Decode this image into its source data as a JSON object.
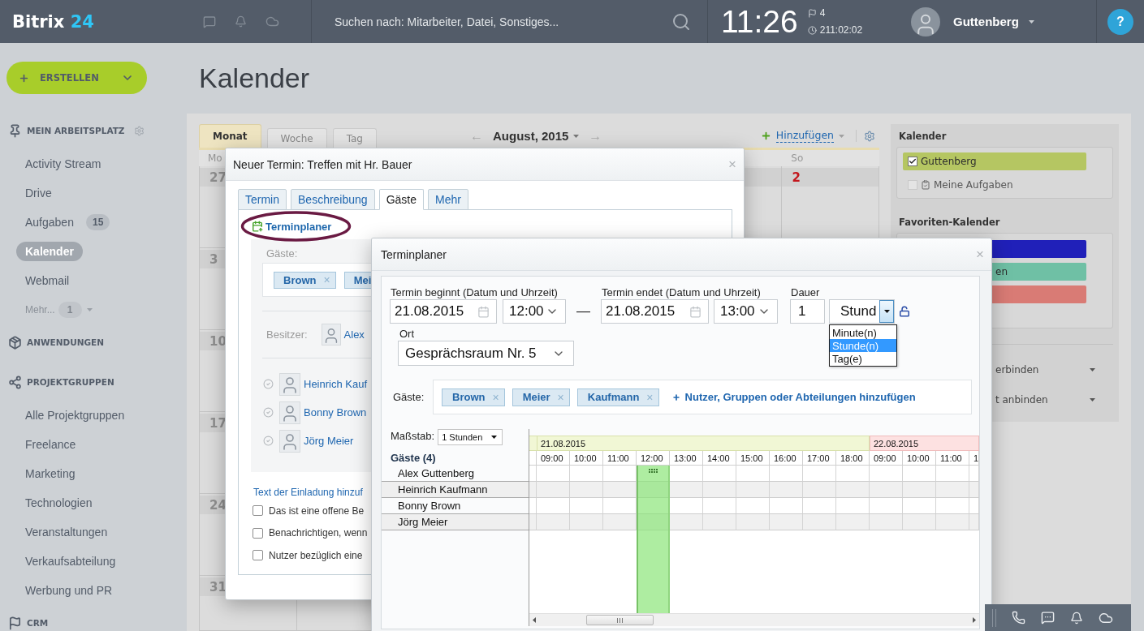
{
  "top_bar": {
    "logo": {
      "name": "Bitrix",
      "number": "24"
    },
    "search": {
      "placeholder": "Suchen nach: Mitarbeiter, Datei, Sonstiges..."
    },
    "time": "11:26",
    "flags": "4",
    "timer": "211:02:02",
    "user": "Guttenberg",
    "help": "?"
  },
  "sidebar": {
    "create_button": "ERSTELLEN",
    "sections": [
      {
        "kind": "workspace",
        "title": "MEIN ARBEITSPLATZ",
        "items": [
          {
            "label": "Activity Stream",
            "selected": false
          },
          {
            "label": "Drive",
            "selected": false
          },
          {
            "label": "Aufgaben",
            "badge": "15",
            "selected": false
          },
          {
            "label": "Kalender",
            "selected": true
          },
          {
            "label": "Webmail",
            "selected": false
          }
        ],
        "more": {
          "label": "Mehr...",
          "badge": "1"
        }
      },
      {
        "kind": "apps",
        "title": "ANWENDUNGEN"
      },
      {
        "kind": "groups",
        "title": "PROJEKTGRUPPEN",
        "items": [
          {
            "label": "Alle Projektgruppen",
            "selected": false
          },
          {
            "label": "Freelance",
            "selected": false
          },
          {
            "label": "Marketing",
            "selected": false
          },
          {
            "label": "Technologien",
            "selected": false
          },
          {
            "label": "Veranstaltungen",
            "selected": false
          },
          {
            "label": "Verkaufsabteilung",
            "selected": false
          },
          {
            "label": "Werbung und PR",
            "selected": false
          }
        ]
      },
      {
        "kind": "crm",
        "title": "CRM"
      }
    ]
  },
  "page_title": "Kalender",
  "calendar": {
    "view_tabs": [
      {
        "label": "Monat",
        "selected": true
      },
      {
        "label": "Woche",
        "selected": false
      },
      {
        "label": "Tag",
        "selected": false
      }
    ],
    "prev": "←",
    "month": "August, 2015",
    "next": "→",
    "add": "Hinzufügen",
    "weekdays": {
      "first": "Mo",
      "last": "So"
    },
    "weeks": [
      {
        "first_day": "27",
        "last_day": "2"
      },
      {
        "first_day": "3"
      },
      {
        "first_day": "10"
      },
      {
        "first_day": "17"
      },
      {
        "first_day": "24"
      },
      {
        "first_day": "31"
      }
    ]
  },
  "right_panel": {
    "calendars_title": "Kalender",
    "calendars": [
      {
        "kind": "calendar",
        "label": "Guttenberg",
        "checked": true,
        "color": "#b5c662"
      },
      {
        "kind": "tasks",
        "label": "Meine Aufgaben",
        "checked": false
      }
    ],
    "favorites_title": "Favoriten-Kalender",
    "favorites": [
      {
        "color": "#2020b9"
      },
      {
        "label": "en",
        "color": "#6fc0a5"
      },
      {
        "color": "#d97b75"
      }
    ],
    "links": [
      {
        "label": "erbinden"
      },
      {
        "label": "t anbinden"
      }
    ]
  },
  "event_dialog": {
    "title": "Neuer Termin: Treffen mit Hr. Bauer",
    "close": "×",
    "tabs": [
      {
        "label": "Termin",
        "selected": false
      },
      {
        "label": "Beschreibung",
        "selected": false
      },
      {
        "label": "Gäste",
        "selected": true
      },
      {
        "label": "Mehr",
        "selected": false
      }
    ],
    "planner_link": "Terminplaner",
    "guests_label": "Gäste:",
    "guest_tags": [
      {
        "label": "Brown",
        "remove": "×"
      },
      {
        "label": "Mei"
      }
    ],
    "owner_label": "Besitzer:",
    "owner": "Alex",
    "guests": [
      {
        "name": "Heinrich Kauf"
      },
      {
        "name": "Bonny Brown"
      },
      {
        "name": "Jörg Meier"
      }
    ],
    "invite_link": "Text der Einladung hinzuf",
    "options": [
      {
        "label": "Das ist eine offene Be",
        "checked": false
      },
      {
        "label": "Benachrichtigen, wenn",
        "checked": false
      },
      {
        "label": "Nutzer bezüglich eine",
        "checked": false
      }
    ]
  },
  "planner_dialog": {
    "title": "Terminplaner",
    "close": "×",
    "start_label": "Termin beginnt (Datum und Uhrzeit)",
    "start_date": "21.08.2015",
    "start_time": "12:00",
    "range_dash": "—",
    "end_label": "Termin endet (Datum und Uhrzeit)",
    "end_date": "21.08.2015",
    "end_time": "13:00",
    "duration_label": "Dauer",
    "duration": "1",
    "unit": "Stund",
    "unit_expanded": true,
    "unit_options": [
      {
        "label": "Minute(n)",
        "selected": false
      },
      {
        "label": "Stunde(n)",
        "selected": true
      },
      {
        "label": "Tag(e)",
        "selected": false
      }
    ],
    "location_label": "Ort",
    "location": "Gesprächsraum Nr. 5",
    "guests_label": "Gäste:",
    "guest_tags": [
      {
        "label": "Brown",
        "remove": "×"
      },
      {
        "label": "Meier",
        "remove": "×"
      },
      {
        "label": "Kaufmann",
        "remove": "×"
      }
    ],
    "add_guests": "Nutzer, Gruppen oder Abteilungen hinzufügen",
    "scale_label": "Maßstab:",
    "scale": "1 Stunden",
    "guests_heading": "Gäste (4)",
    "guests": [
      "Alex Guttenberg",
      "Heinrich Kaufmann",
      "Bonny Brown",
      "Jörg Meier"
    ],
    "dates": [
      {
        "label": "21.08.2015",
        "weekend": false,
        "hours": [
          {
            "label": "09:00",
            "selected": false
          },
          {
            "label": "10:00",
            "selected": false
          },
          {
            "label": "11:00",
            "selected": false
          },
          {
            "label": "12:00",
            "selected": true
          },
          {
            "label": "13:00",
            "selected": false
          },
          {
            "label": "14:00",
            "selected": false
          },
          {
            "label": "15:00",
            "selected": false
          },
          {
            "label": "16:00",
            "selected": false
          },
          {
            "label": "17:00",
            "selected": false
          },
          {
            "label": "18:00",
            "selected": false
          }
        ]
      },
      {
        "label": "22.08.2015",
        "weekend": true,
        "hours": [
          {
            "label": "09:00",
            "selected": false
          },
          {
            "label": "10:00",
            "selected": false
          },
          {
            "label": "11:00",
            "selected": false
          },
          {
            "label": "1",
            "selected": false
          }
        ]
      }
    ]
  }
}
